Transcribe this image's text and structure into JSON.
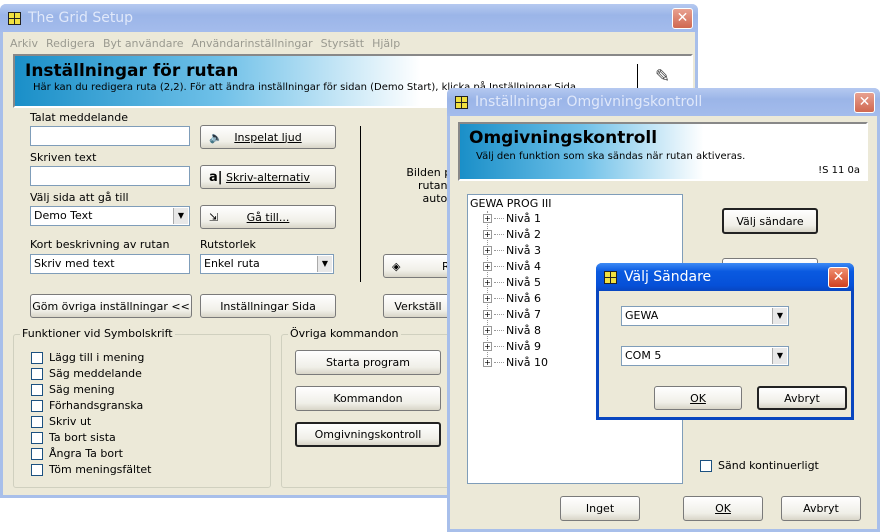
{
  "main": {
    "title": "The Grid Setup",
    "menu": [
      "Arkiv",
      "Redigera",
      "Byt användare",
      "Användarinställningar",
      "Styrsätt",
      "Hjälp"
    ],
    "banner_title": "Inställningar för rutan",
    "banner_sub": "Här kan du redigera ruta (2,2). För att ändra inställningar för sidan (Demo Start), klicka på Inställningar Sida",
    "talat_label": "Talat meddelande",
    "talat_value": "",
    "inspelat": "Inspelat ljud",
    "skriven_label": "Skriven text",
    "skriven_value": "",
    "skriv_alt": "Skriv-alternativ",
    "valj_sida_label": "Välj sida att gå till",
    "valj_sida_value": "Demo Text",
    "ga_till": "Gå till...",
    "kort_label": "Kort beskrivning av rutan",
    "kort_value": "Skriv med text",
    "rutstorlek_label": "Rutstorlek",
    "rutstorlek_value": "Enkel ruta",
    "bilden_text": "Bilden på\nrutan h\nautom",
    "r_button": "R",
    "gom": "Göm övriga inställningar <<",
    "inst_sida": "Inställningar Sida",
    "verkstall": "Verkställ",
    "funk_title": "Funktioner vid Symbolskrift",
    "funk": [
      "Lägg till i mening",
      "Säg meddelande",
      "Säg mening",
      "Förhandsgranska",
      "Skriv ut",
      "Ta bort sista",
      "Ångra Ta bort",
      "Töm meningsfältet"
    ],
    "ovriga_title": "Övriga kommandon",
    "ovriga": [
      "Starta program",
      "Kommandon",
      "Omgivningskontroll"
    ]
  },
  "omg": {
    "title": "Inställningar Omgivningskontroll",
    "banner_title": "Omgivningskontroll",
    "banner_sub": "Välj den funktion som ska sändas när rutan aktiveras.",
    "code": "!S 11 0a",
    "tree_root": "GEWA PROG III",
    "tree": [
      "Nivå 1",
      "Nivå 2",
      "Nivå 3",
      "Nivå 4",
      "Nivå 5",
      "Nivå 6",
      "Nivå 7",
      "Nivå 8",
      "Nivå 9",
      "Nivå 10"
    ],
    "valj_sandare": "Välj sändare",
    "sand_kont": "Sänd kontinuerligt",
    "inget": "Inget",
    "ok": "OK",
    "avbryt": "Avbryt"
  },
  "dlg": {
    "title": "Välj Sändare",
    "sender": "GEWA",
    "port": "COM 5",
    "ok": "OK",
    "avbryt": "Avbryt"
  }
}
